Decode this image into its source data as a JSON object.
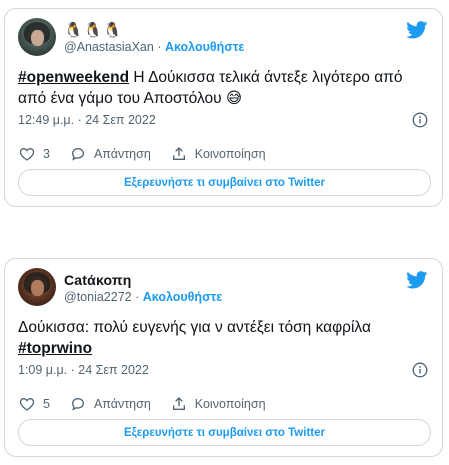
{
  "colors": {
    "accent": "#1d9bf0",
    "secondary_text": "#536471",
    "border": "#cfd9de"
  },
  "tweets": [
    {
      "display_name": "🐧🐧🐧",
      "handle": "@AnastasiaXan",
      "separator": "·",
      "follow_label": "Ακολουθήστε",
      "hashtag": "#openweekend",
      "text": " Η Δούκισσα τελικά άντεξε λιγότερο από από ένα γάμο του Αποστόλου 😅",
      "time": "12:49 μ.μ. · 24 Σεπ 2022",
      "likes": "3",
      "reply_label": "Απάντηση",
      "share_label": "Κοινοποίηση",
      "cta_label": "Εξερευνήστε τι συμβαίνει στο Twitter"
    },
    {
      "display_name": "Catάκοπη",
      "handle": "@tonia2272",
      "separator": "·",
      "follow_label": "Ακολουθήστε",
      "text": "Δούκισσα: πολύ ευγενής για ν αντέξει τόση καφρίλα ",
      "hashtag": "#toprwino",
      "time": "1:09 μ.μ. · 24 Σεπ 2022",
      "likes": "5",
      "reply_label": "Απάντηση",
      "share_label": "Κοινοποίηση",
      "cta_label": "Εξερευνήστε τι συμβαίνει στο Twitter"
    }
  ]
}
